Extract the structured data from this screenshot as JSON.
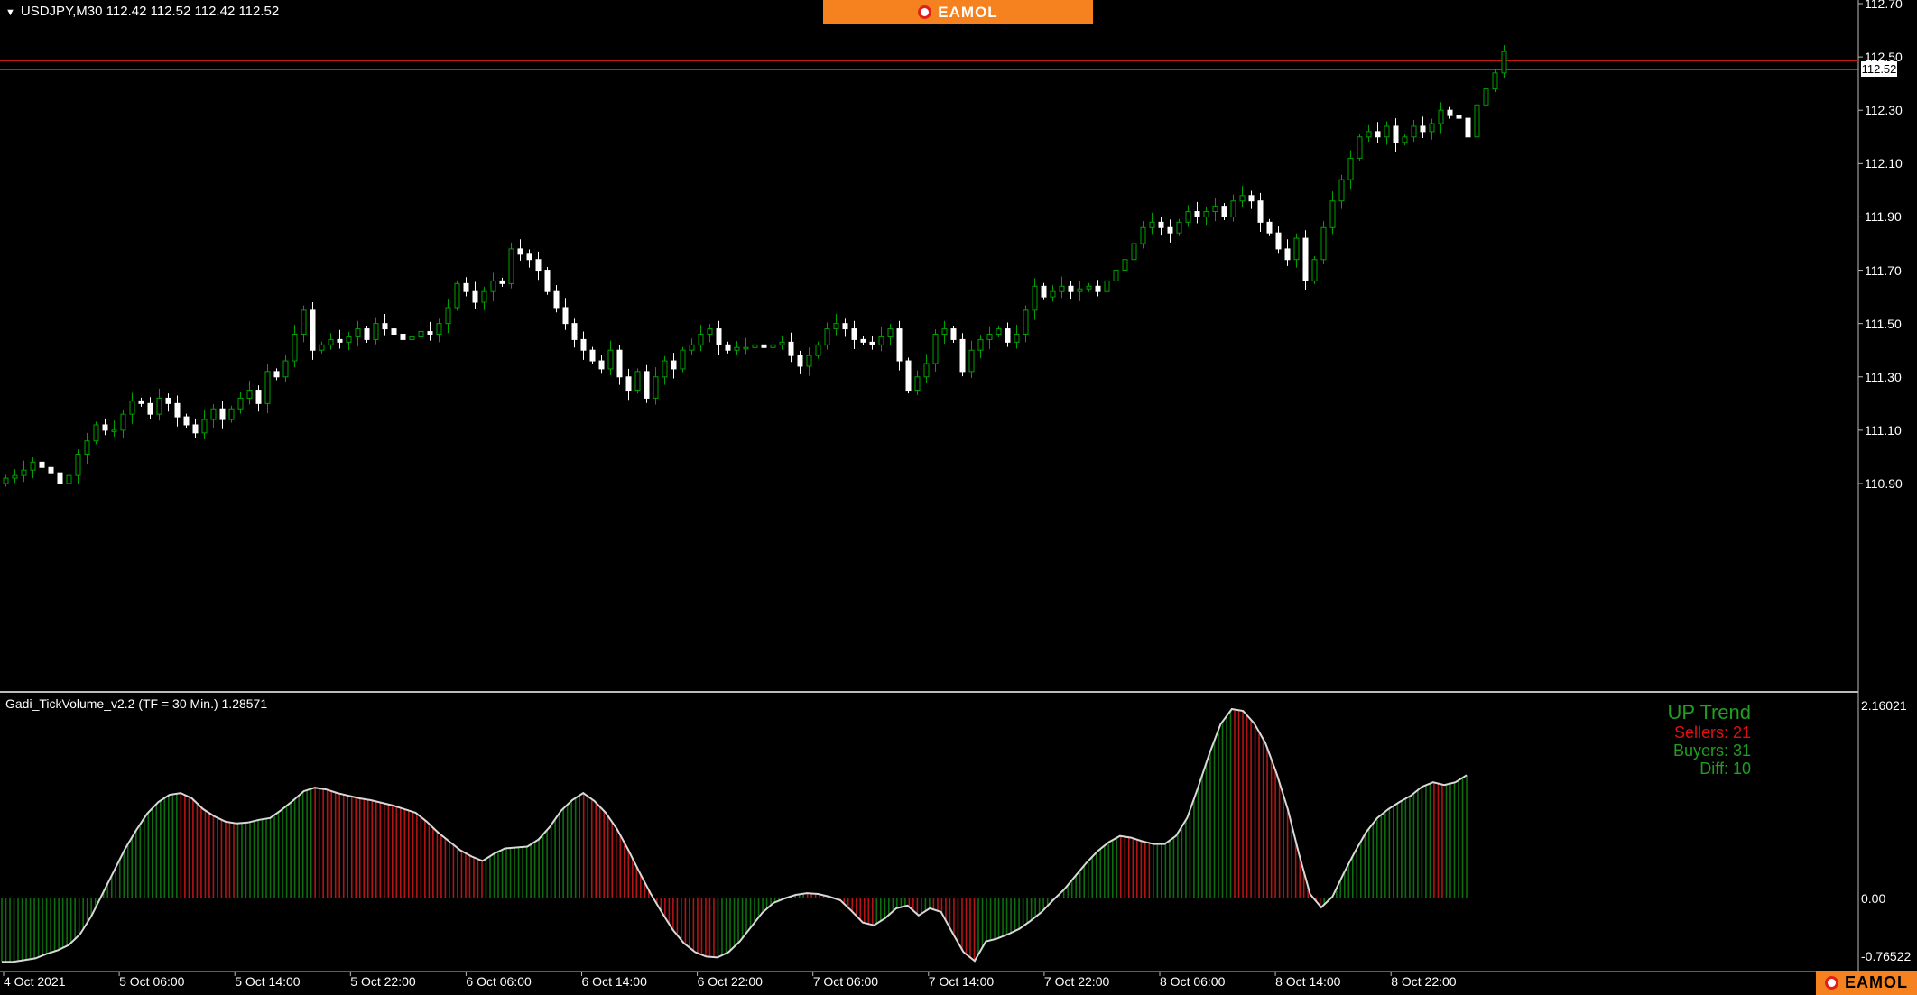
{
  "symbol_header": {
    "text": "USDJPY,M30  112.42 112.52 112.42 112.52"
  },
  "brand": {
    "label": "EAMOL"
  },
  "current_price_tag": "112.52",
  "price_axis": {
    "labels": [
      "112.70",
      "112.50",
      "112.30",
      "112.10",
      "111.90",
      "111.70",
      "111.50",
      "111.30",
      "111.10",
      "110.90"
    ]
  },
  "indicator": {
    "header": "Gadi_TickVolume_v2.2 (TF = 30 Min.) 1.28571",
    "axis_labels": [
      "2.16021",
      "0.00",
      "-0.76522"
    ],
    "trend": {
      "title": "UP Trend",
      "sellers": "Sellers: 21",
      "buyers": "Buyers: 31",
      "diff": "Diff: 10"
    }
  },
  "time_axis": {
    "labels": [
      "4 Oct 2021",
      "5 Oct 06:00",
      "5 Oct 14:00",
      "5 Oct 22:00",
      "6 Oct 06:00",
      "6 Oct 14:00",
      "6 Oct 22:00",
      "7 Oct 06:00",
      "7 Oct 14:00",
      "7 Oct 22:00",
      "8 Oct 06:00",
      "8 Oct 14:00",
      "8 Oct 22:00"
    ]
  },
  "colors": {
    "background": "#000000",
    "up_candle": "#00a000",
    "down_candle": "#ffffff",
    "bid_line": "#c81414",
    "ask_line": "#a0a0a0",
    "hist_up": "#0d6e0d",
    "hist_down": "#b41414",
    "brand": "#f5821f"
  },
  "chart_data": [
    {
      "type": "candlestick",
      "title": "USDJPY,M30",
      "ylim": [
        110.83,
        112.7
      ],
      "x_labels": [
        "4 Oct 2021",
        "5 Oct 06:00",
        "5 Oct 14:00",
        "5 Oct 22:00",
        "6 Oct 06:00",
        "6 Oct 14:00",
        "6 Oct 22:00",
        "7 Oct 06:00",
        "7 Oct 14:00",
        "7 Oct 22:00",
        "8 Oct 06:00",
        "8 Oct 14:00",
        "8 Oct 22:00"
      ],
      "closes": [
        110.92,
        110.93,
        110.95,
        110.98,
        110.96,
        110.94,
        110.9,
        110.93,
        111.01,
        111.06,
        111.12,
        111.1,
        111.1,
        111.16,
        111.21,
        111.2,
        111.16,
        111.22,
        111.2,
        111.15,
        111.12,
        111.09,
        111.14,
        111.18,
        111.14,
        111.18,
        111.22,
        111.25,
        111.2,
        111.32,
        111.3,
        111.36,
        111.46,
        111.55,
        111.4,
        111.42,
        111.44,
        111.43,
        111.45,
        111.48,
        111.44,
        111.5,
        111.48,
        111.46,
        111.44,
        111.45,
        111.47,
        111.46,
        111.5,
        111.56,
        111.65,
        111.62,
        111.58,
        111.62,
        111.66,
        111.65,
        111.78,
        111.76,
        111.74,
        111.7,
        111.62,
        111.56,
        111.5,
        111.44,
        111.4,
        111.36,
        111.33,
        111.4,
        111.3,
        111.25,
        111.32,
        111.22,
        111.3,
        111.36,
        111.33,
        111.4,
        111.42,
        111.46,
        111.48,
        111.42,
        111.4,
        111.41,
        111.41,
        111.42,
        111.41,
        111.42,
        111.43,
        111.38,
        111.34,
        111.38,
        111.42,
        111.48,
        111.5,
        111.48,
        111.44,
        111.43,
        111.42,
        111.45,
        111.48,
        111.36,
        111.25,
        111.3,
        111.35,
        111.46,
        111.48,
        111.44,
        111.32,
        111.4,
        111.44,
        111.46,
        111.48,
        111.43,
        111.46,
        111.55,
        111.64,
        111.6,
        111.62,
        111.64,
        111.62,
        111.63,
        111.64,
        111.62,
        111.66,
        111.7,
        111.74,
        111.8,
        111.86,
        111.88,
        111.86,
        111.84,
        111.88,
        111.92,
        111.9,
        111.92,
        111.94,
        111.9,
        111.96,
        111.98,
        111.96,
        111.88,
        111.84,
        111.78,
        111.74,
        111.82,
        111.66,
        111.74,
        111.86,
        111.96,
        112.04,
        112.12,
        112.2,
        112.22,
        112.2,
        112.24,
        112.18,
        112.2,
        112.24,
        112.22,
        112.25,
        112.3,
        112.28,
        112.27,
        112.2,
        112.32,
        112.38,
        112.44,
        112.52
      ]
    },
    {
      "type": "area",
      "title": "Gadi_TickVolume_v2.2 (TF = 30 Min.) 1.28571",
      "ylim": [
        -0.76522,
        2.16021
      ],
      "x_labels": [
        "4 Oct 2021",
        "5 Oct 06:00",
        "5 Oct 14:00",
        "5 Oct 22:00",
        "6 Oct 06:00",
        "6 Oct 14:00",
        "6 Oct 22:00",
        "7 Oct 06:00",
        "7 Oct 14:00",
        "7 Oct 22:00",
        "8 Oct 06:00",
        "8 Oct 14:00",
        "8 Oct 22:00"
      ],
      "series": [
        {
          "values": [
            -0.71,
            -0.71,
            -0.69,
            -0.67,
            -0.62,
            -0.58,
            -0.52,
            -0.4,
            -0.2,
            0.05,
            0.3,
            0.55,
            0.76,
            0.95,
            1.08,
            1.16,
            1.18,
            1.12,
            1.0,
            0.92,
            0.86,
            0.84,
            0.85,
            0.88,
            0.9,
            0.99,
            1.09,
            1.2,
            1.24,
            1.22,
            1.18,
            1.15,
            1.12,
            1.1,
            1.07,
            1.04,
            1.0,
            0.96,
            0.86,
            0.74,
            0.64,
            0.54,
            0.47,
            0.42,
            0.5,
            0.56,
            0.57,
            0.58,
            0.66,
            0.8,
            0.98,
            1.1,
            1.18,
            1.09,
            0.96,
            0.78,
            0.55,
            0.3,
            0.06,
            -0.15,
            -0.35,
            -0.5,
            -0.6,
            -0.65,
            -0.66,
            -0.6,
            -0.48,
            -0.32,
            -0.16,
            -0.05,
            0.0,
            0.04,
            0.06,
            0.05,
            0.02,
            -0.02,
            -0.14,
            -0.27,
            -0.3,
            -0.22,
            -0.11,
            -0.08,
            -0.19,
            -0.11,
            -0.15,
            -0.38,
            -0.6,
            -0.7,
            -0.48,
            -0.45,
            -0.4,
            -0.34,
            -0.25,
            -0.15,
            -0.02,
            0.1,
            0.25,
            0.4,
            0.53,
            0.63,
            0.7,
            0.68,
            0.64,
            0.61,
            0.61,
            0.7,
            0.9,
            1.25,
            1.62,
            1.95,
            2.12,
            2.1,
            1.96,
            1.74,
            1.4,
            1.0,
            0.5,
            0.05,
            -0.1,
            0.02,
            0.28,
            0.52,
            0.74,
            0.9,
            1.0,
            1.08,
            1.15,
            1.25,
            1.3,
            1.27,
            1.3,
            1.38
          ]
        }
      ]
    }
  ]
}
